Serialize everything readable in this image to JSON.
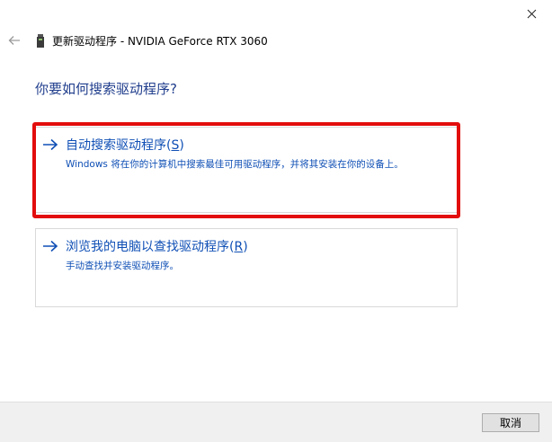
{
  "window": {
    "title": "更新驱动程序 - NVIDIA GeForce RTX 3060",
    "close_glyph": "✕",
    "back_glyph": "←"
  },
  "heading": "你要如何搜索驱动程序?",
  "options": [
    {
      "label": "自动搜索驱动程序",
      "access_key": "S",
      "description": "Windows 将在你的计算机中搜索最佳可用驱动程序，并将其安装在你的设备上。",
      "highlighted": true
    },
    {
      "label": "浏览我的电脑以查找驱动程序",
      "access_key": "R",
      "description": "手动查找并安装驱动程序。",
      "highlighted": false
    }
  ],
  "footer": {
    "cancel_label": "取消"
  },
  "colors": {
    "link": "#0f4fb5",
    "heading": "#1f3d8c",
    "highlight": "#e30d0d",
    "footer_bg": "#f0f0f0"
  },
  "icons": {
    "back": "back-arrow-icon",
    "device": "device-icon",
    "option_arrow": "arrow-right-icon",
    "close": "close-icon"
  }
}
